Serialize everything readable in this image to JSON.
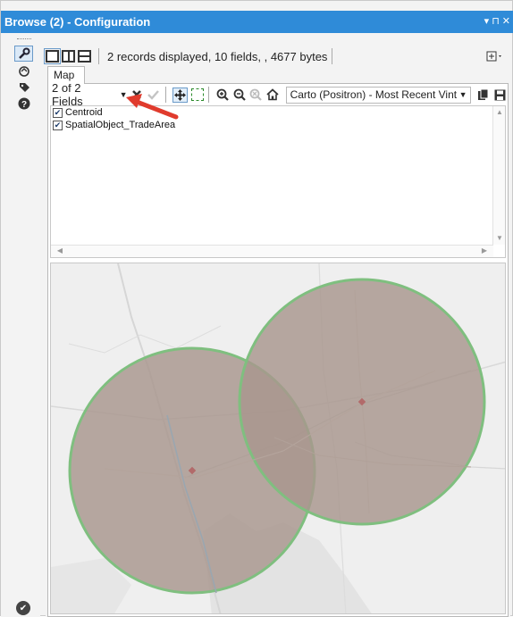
{
  "window": {
    "title": "Browse (2) - Configuration",
    "controls": [
      "▾",
      "⊓",
      "✕"
    ]
  },
  "rail": {
    "items": [
      {
        "icon": "wrench-icon",
        "glyph": "🔧"
      },
      {
        "icon": "cycle-icon",
        "glyph": "⟲"
      },
      {
        "icon": "tag-icon",
        "glyph": "◆"
      },
      {
        "icon": "help-icon",
        "glyph": "?"
      }
    ],
    "bottom_icon": "check-circle-icon"
  },
  "toolbar": {
    "records_text": "2 records displayed, 10 fields, , 4677 bytes",
    "options_glyph": "⊡▾"
  },
  "tabs": [
    {
      "label": "Map",
      "active": true
    }
  ],
  "map_toolbar": {
    "fields_selector": "2 of 2 Fields",
    "basemap": "Carto (Positron) - Most Recent Vint",
    "buttons": [
      {
        "icon": "clear-icon",
        "glyph": "✖"
      },
      {
        "icon": "apply-check-icon",
        "glyph": "✔"
      },
      {
        "icon": "pan-icon",
        "glyph": "✥"
      },
      {
        "icon": "select-rectangle-icon",
        "glyph": ""
      },
      {
        "icon": "zoom-in-icon",
        "glyph": "⊕"
      },
      {
        "icon": "zoom-out-icon",
        "glyph": "⊖"
      },
      {
        "icon": "zoom-extent-icon",
        "glyph": "⊗"
      },
      {
        "icon": "home-icon",
        "glyph": "⌂"
      },
      {
        "icon": "copy-icon",
        "glyph": "❐"
      },
      {
        "icon": "save-icon",
        "glyph": "▣"
      }
    ]
  },
  "fields": [
    {
      "label": "Centroid",
      "checked": true
    },
    {
      "label": "SpatialObject_TradeArea",
      "checked": true
    }
  ],
  "map": {
    "trade_areas": 2,
    "circle_fill": "#a8968e",
    "circle_stroke": "#7fbf7f",
    "centroid_color": "#b26a6a",
    "basemap_bg": "#efefef"
  },
  "colors": {
    "titlebar": "#2f8bd8",
    "annotation_arrow": "#e03b2d"
  }
}
